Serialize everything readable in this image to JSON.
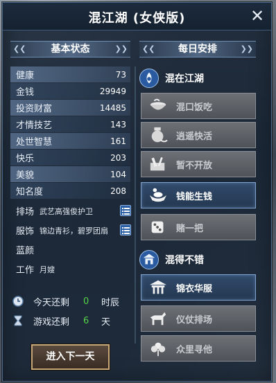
{
  "window": {
    "title": "混江湖 (女侠版)",
    "close": "✕"
  },
  "left": {
    "heading": "基本状态",
    "stats": [
      {
        "label": "健康",
        "value": "73"
      },
      {
        "label": "金钱",
        "value": "29949"
      },
      {
        "label": "投资财富",
        "value": "14485"
      },
      {
        "label": "才情技艺",
        "value": "143"
      },
      {
        "label": "处世智慧",
        "value": "161"
      },
      {
        "label": "快乐",
        "value": "203"
      },
      {
        "label": "美貌",
        "value": "104"
      },
      {
        "label": "知名度",
        "value": "208"
      }
    ],
    "entourage_label": "排场",
    "entourage_value": "武艺高强俊护卫",
    "outfit_label": "服饰",
    "outfit_value": "锦边青衫，碧罗团扇",
    "companion_label": "蓝颜",
    "companion_value": "",
    "job_label": "工作",
    "job_value": "月嫂",
    "today_label": "今天还剩",
    "today_value": "0",
    "today_unit": "时辰",
    "game_label": "游戏还剩",
    "game_value": "6",
    "game_unit": "天",
    "next_day": "进入下一天"
  },
  "right": {
    "heading": "每日安排",
    "group1_title": "混在江湖",
    "group1_buttons": [
      "混口饭吃",
      "逍遥快活",
      "暂不开放",
      "钱能生钱",
      "赌一把"
    ],
    "group2_title": "混得不错",
    "group2_buttons": [
      "锦衣华服",
      "仪仗排场",
      "众里寻他"
    ]
  },
  "colors": {
    "accent": "#56d24a",
    "enabled_border": "#7fa3cf",
    "disabled_bg": "#5f6368"
  }
}
